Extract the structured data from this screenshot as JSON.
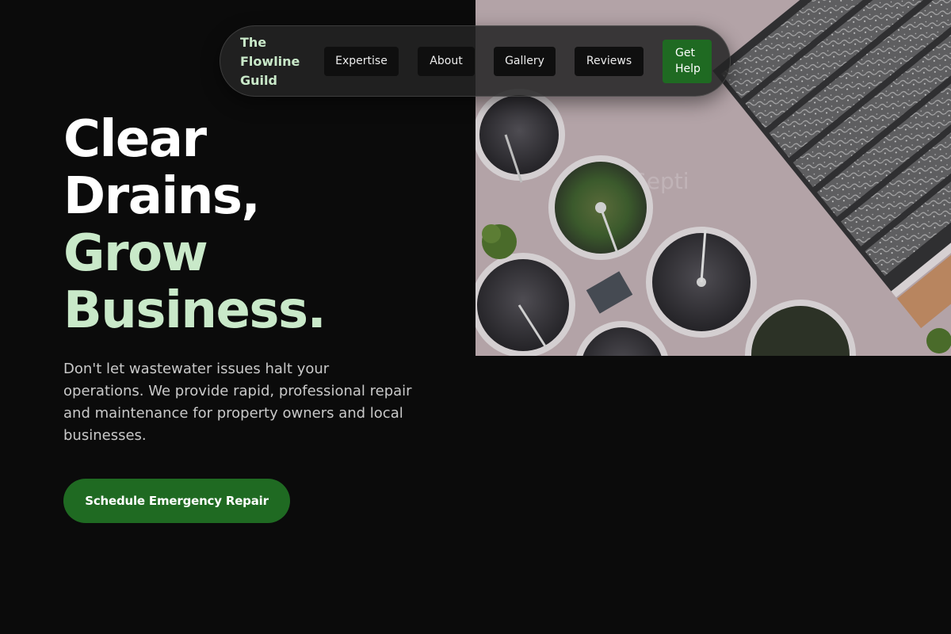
{
  "nav": {
    "brand": "The Flowline Guild",
    "links": [
      {
        "label": "Expertise"
      },
      {
        "label": "About"
      },
      {
        "label": "Gallery"
      },
      {
        "label": "Reviews"
      }
    ],
    "cta_label": "Get Help"
  },
  "hero": {
    "headline_white": [
      "Clear",
      "Drains,"
    ],
    "headline_green": [
      "Grow",
      "Business."
    ],
    "description": "Don't let wastewater issues halt your operations. We provide rapid, professional repair and maintenance for property owners and local businesses.",
    "cta_label": "Schedule Emergency Repair"
  },
  "colors": {
    "background": "#0b0b0b",
    "accent_green": "#1f6a22",
    "headline_green": "#c9e9c9",
    "body_text": "#c9c9c9"
  }
}
